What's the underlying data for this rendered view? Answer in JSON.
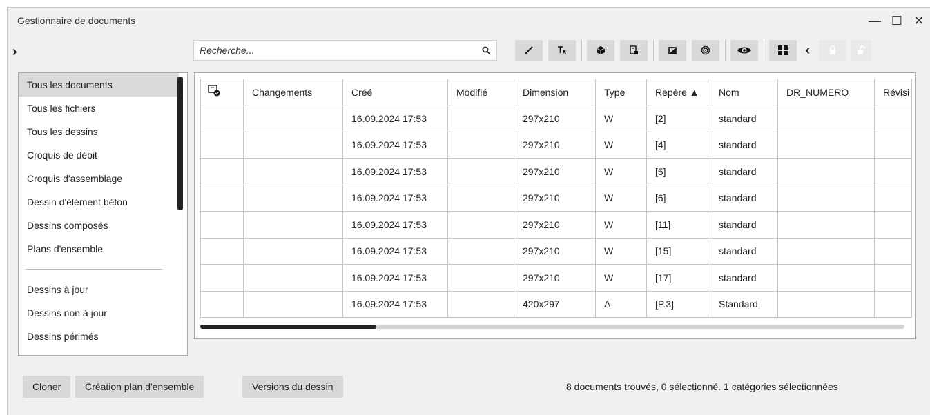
{
  "window": {
    "title": "Gestionnaire de documents",
    "minimize": "—",
    "maximize": "☐",
    "close": "✕"
  },
  "search": {
    "placeholder": "Recherche..."
  },
  "sidebar": {
    "items_top": [
      "Tous les documents",
      "Tous les fichiers",
      "Tous les dessins",
      "Croquis de débit",
      "Croquis d'assemblage",
      "Dessin d'élément béton",
      "Dessins composés",
      "Plans d'ensemble"
    ],
    "items_bottom": [
      "Dessins à jour",
      "Dessins non à jour",
      "Dessins périmés"
    ]
  },
  "table": {
    "headers": [
      "",
      "Changements",
      "Créé",
      "Modifié",
      "Dimension",
      "Type",
      "Repère ▲",
      "Nom",
      "DR_NUMERO",
      "Révisi"
    ],
    "rows": [
      [
        "",
        "",
        "16.09.2024 17:53",
        "",
        "297x210",
        "W",
        "[2]",
        "standard",
        "",
        ""
      ],
      [
        "",
        "",
        "16.09.2024 17:53",
        "",
        "297x210",
        "W",
        "[4]",
        "standard",
        "",
        ""
      ],
      [
        "",
        "",
        "16.09.2024 17:53",
        "",
        "297x210",
        "W",
        "[5]",
        "standard",
        "",
        ""
      ],
      [
        "",
        "",
        "16.09.2024 17:53",
        "",
        "297x210",
        "W",
        "[6]",
        "standard",
        "",
        ""
      ],
      [
        "",
        "",
        "16.09.2024 17:53",
        "",
        "297x210",
        "W",
        "[11]",
        "standard",
        "",
        ""
      ],
      [
        "",
        "",
        "16.09.2024 17:53",
        "",
        "297x210",
        "W",
        "[15]",
        "standard",
        "",
        ""
      ],
      [
        "",
        "",
        "16.09.2024 17:53",
        "",
        "297x210",
        "W",
        "[17]",
        "standard",
        "",
        ""
      ],
      [
        "",
        "",
        "16.09.2024 17:53",
        "",
        "420x297",
        "A",
        "[P.3]",
        "Standard",
        "",
        ""
      ]
    ]
  },
  "buttons": {
    "clone": "Cloner",
    "create_plan": "Création plan d'ensemble",
    "versions": "Versions du dessin"
  },
  "status": "8 documents trouvés, 0 sélectionné. 1 catégories sélectionnées"
}
